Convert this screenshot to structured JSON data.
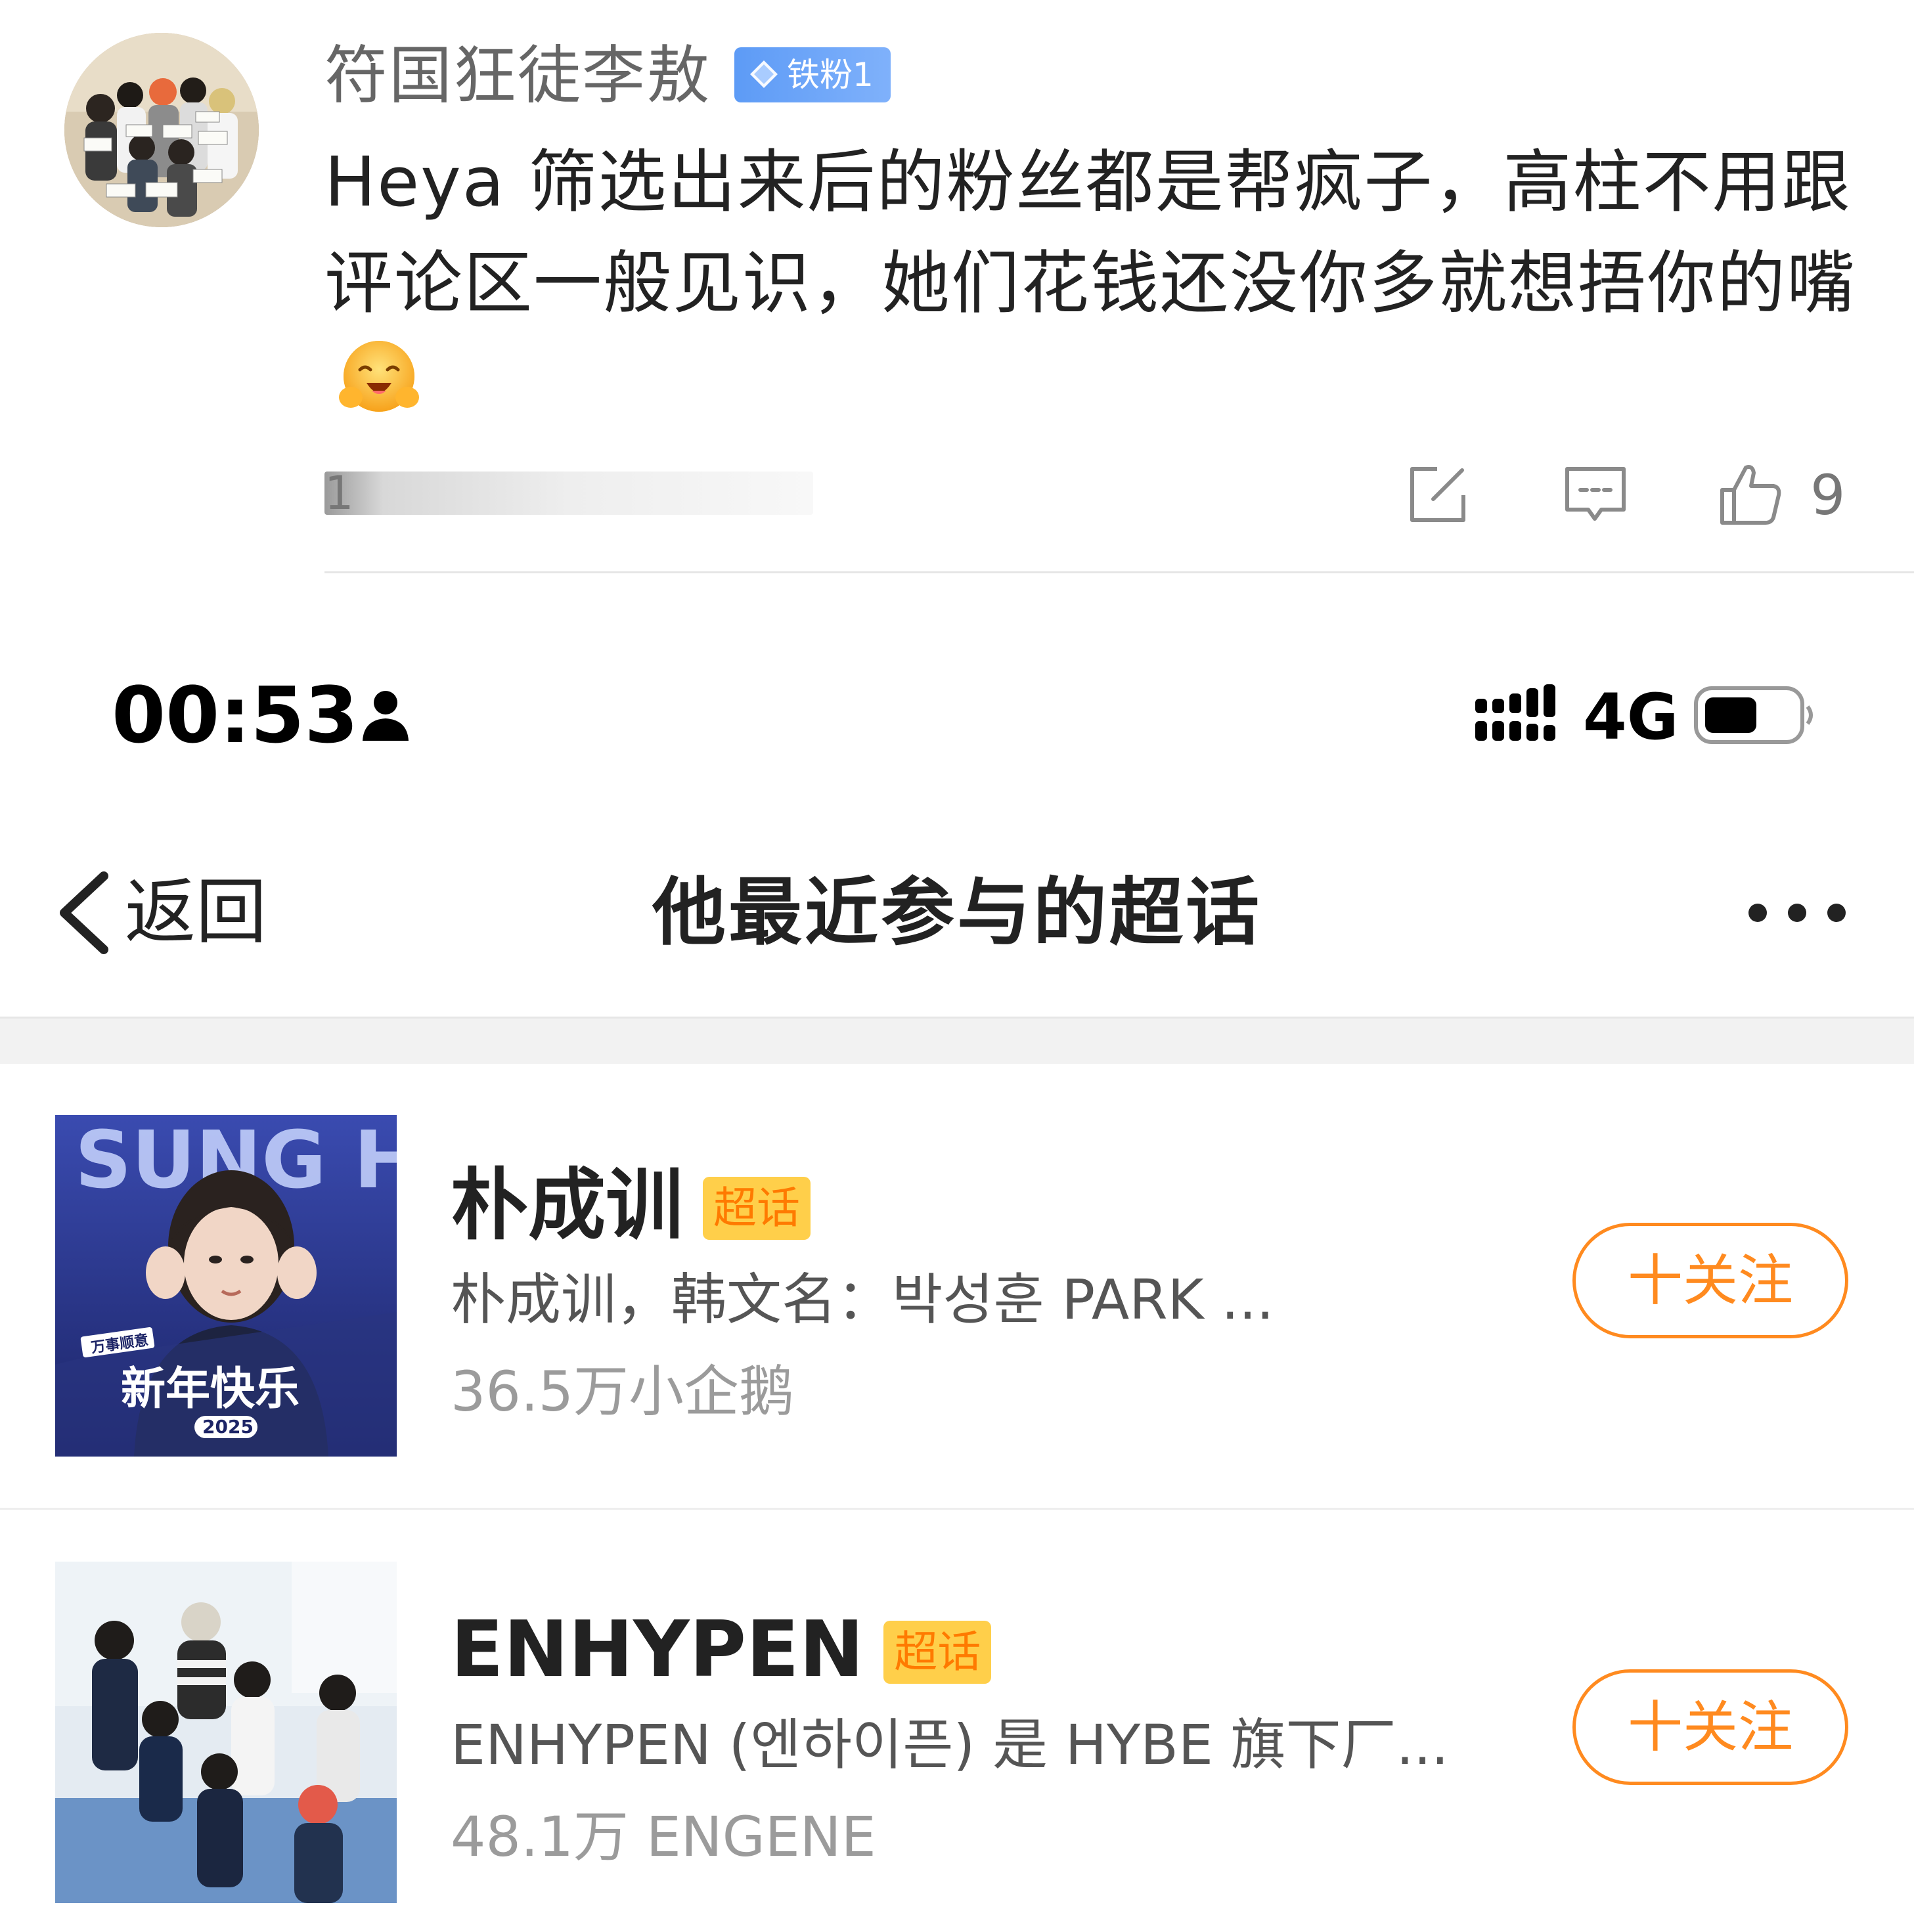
{
  "comment": {
    "username": "符国狂徒李敖",
    "fan_badge": "铁粉1",
    "text": "Heya 筛选出来后的粉丝都是帮疯子，高柱不用跟评论区一般见识，她们花钱还没你多就想捂你的嘴",
    "timestamp_visible": "1",
    "like_count": "9",
    "emoji_icon": "hug-smile-emoji",
    "action_icons": [
      "share-icon",
      "reply-icon",
      "thumbs-up-icon"
    ]
  },
  "status_bar": {
    "time": "00:53",
    "network": "4G",
    "icons": [
      "person-icon",
      "signal-icon",
      "battery-icon"
    ]
  },
  "nav": {
    "back_label": "返回",
    "title": "他最近参与的超话",
    "more_icon": "more-dots-icon"
  },
  "topics": [
    {
      "name": "朴成训",
      "badge": "超话",
      "description": "朴成训，韩文名：박성훈 PARK ...",
      "fans": "36.5万小企鹅",
      "follow_label": "十关注",
      "cover": {
        "title_text": "SUNG HOON",
        "greeting": "新年快乐",
        "year": "2025",
        "tag": "万事顺意"
      }
    },
    {
      "name": "ENHYPEN",
      "badge": "超话",
      "description": "ENHYPEN (엔하이픈) 是 HYBE 旗下厂...",
      "fans": "48.1万 ENGENE",
      "follow_label": "十关注"
    }
  ],
  "colors": {
    "accent_orange": "#ff8a1f",
    "badge_yellow": "#ffcf4a",
    "fan_badge_blue": "#5d9bf6",
    "divider_gray": "#e6e6e6"
  }
}
